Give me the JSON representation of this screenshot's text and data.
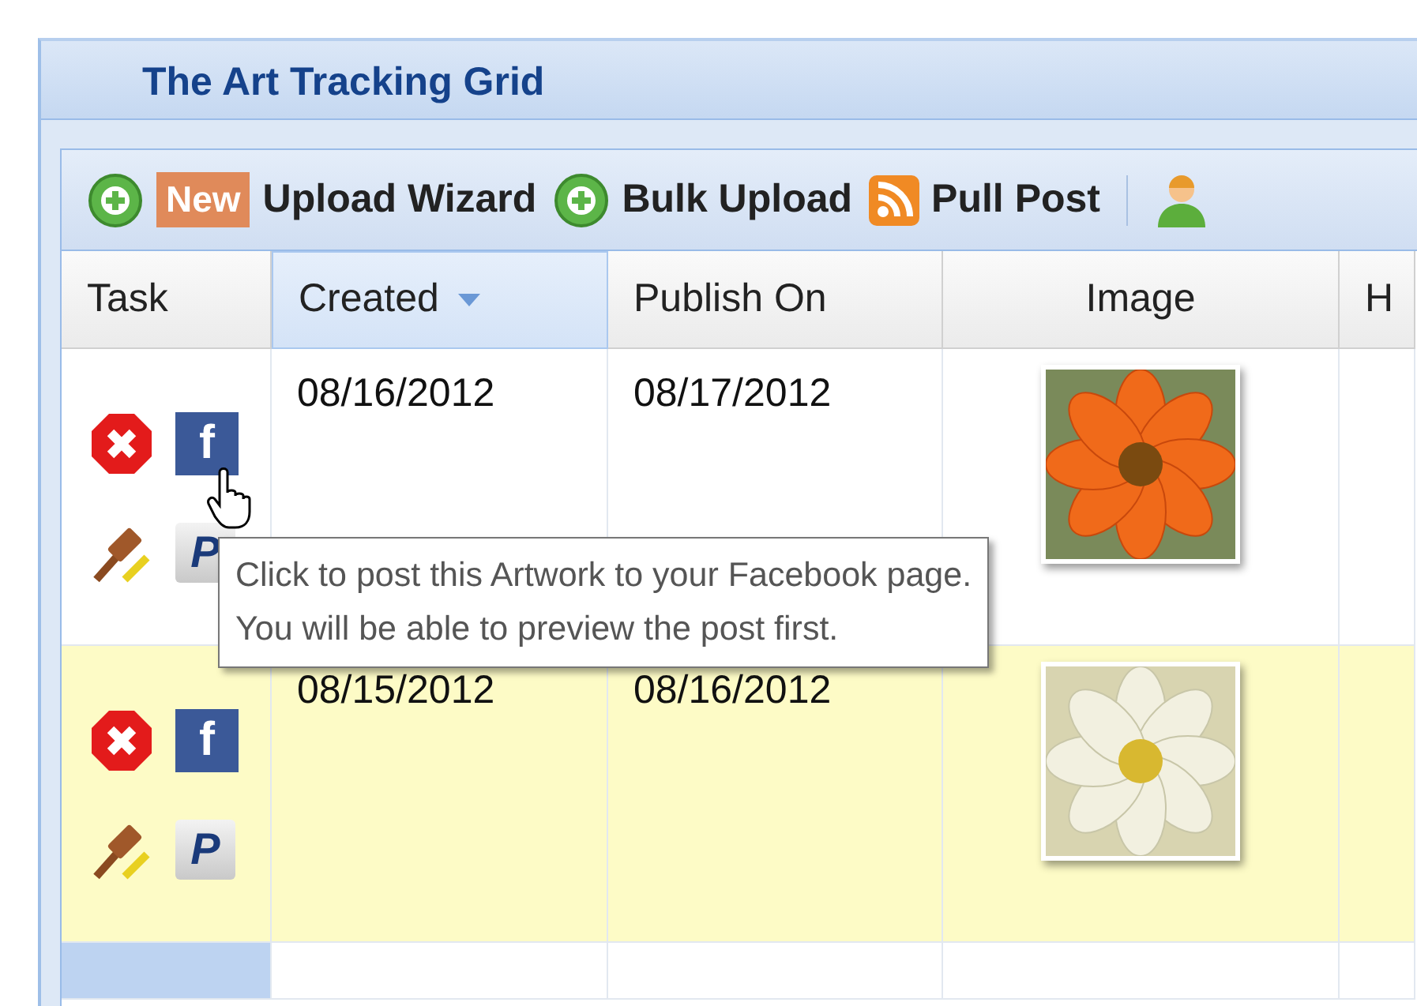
{
  "panel": {
    "title": "The Art Tracking Grid"
  },
  "toolbar": [
    {
      "kind": "add",
      "badge": "New",
      "label": "Upload Wizard"
    },
    {
      "kind": "add",
      "label": "Bulk Upload"
    },
    {
      "kind": "feed",
      "label": "Pull Post"
    },
    {
      "kind": "separator"
    },
    {
      "kind": "user"
    }
  ],
  "table": {
    "columns": [
      {
        "label": "Task",
        "sorted": false
      },
      {
        "label": "Created",
        "sorted": true
      },
      {
        "label": "Publish On",
        "sorted": false
      },
      {
        "label": "Image",
        "sorted": false
      },
      {
        "label": "H",
        "sorted": false
      }
    ],
    "rows": [
      {
        "highlighted": false,
        "selected": false,
        "post_icon": "f",
        "pay_icon": "P",
        "created": "08/16/2012",
        "publish_on": "08/17/2012"
      },
      {
        "highlighted": true,
        "selected": false,
        "post_icon": "f",
        "pay_icon": "P",
        "created": "08/15/2012",
        "publish_on": "08/16/2012"
      },
      {
        "highlighted": false,
        "selected": true
      }
    ]
  },
  "tooltip": {
    "lines": [
      "Click to post this Artwork to your Facebook page.",
      "You will be able to preview the post first."
    ]
  }
}
